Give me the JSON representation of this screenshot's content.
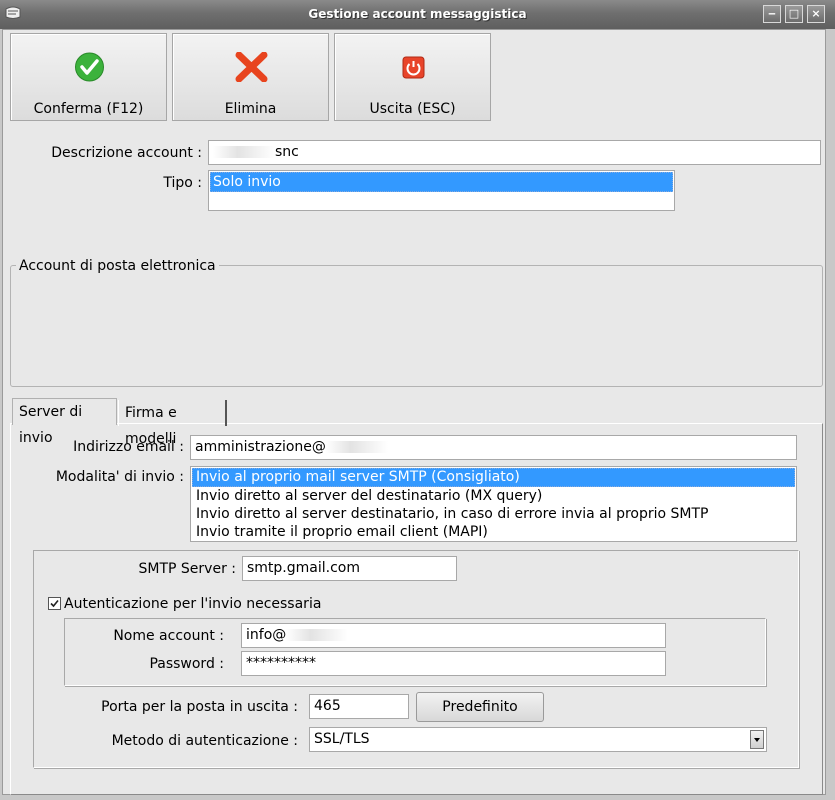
{
  "window": {
    "title": "Gestione account messaggistica"
  },
  "toolbar": {
    "confirm_label": "Conferma (F12)",
    "delete_label": "Elimina",
    "exit_label": "Uscita (ESC)"
  },
  "account": {
    "description_label": "Descrizione account :",
    "description_value": "snc",
    "type_label": "Tipo :",
    "type_options": [
      "Solo invio"
    ]
  },
  "email_group": {
    "legend": "Account di posta elettronica"
  },
  "tabs": [
    "Server di invio",
    "Firma e modelli"
  ],
  "server": {
    "email_label": "Indirizzo email :",
    "email_value": "amministrazione@",
    "mode_label": "Modalita' di invio :",
    "mode_options": [
      "Invio al proprio mail server SMTP (Consigliato)",
      "Invio diretto al server del destinatario (MX query)",
      "Invio diretto al server destinatario, in caso di errore invia al proprio SMTP",
      "Invio tramite il proprio email client (MAPI)"
    ],
    "smtp_label": "SMTP Server :",
    "smtp_value": "smtp.gmail.com",
    "auth_checkbox_label": "Autenticazione per l'invio necessaria",
    "account_name_label": "Nome account :",
    "account_name_value": "info@",
    "password_label": "Password :",
    "password_value": "**********",
    "port_label": "Porta per la posta in uscita :",
    "port_value": "465",
    "default_button": "Predefinito",
    "auth_method_label": "Metodo di autenticazione :",
    "auth_method_value": "SSL/TLS"
  }
}
